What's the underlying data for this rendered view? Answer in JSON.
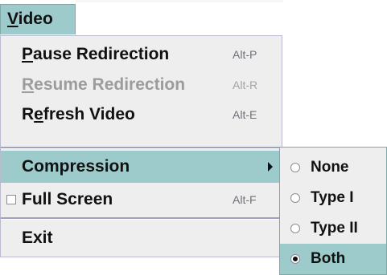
{
  "menubar": {
    "title_first": "V",
    "title_rest": "ideo"
  },
  "menu": {
    "pause_redirection": {
      "label_first": "P",
      "label_rest": "ause Redirection",
      "accelerator": "Alt-P"
    },
    "resume_redirection": {
      "label_first": "R",
      "label_rest": "esume Redirection",
      "accelerator": "Alt-R"
    },
    "refresh_video": {
      "label_before": "R",
      "label_mnemonic": "e",
      "label_after": "fresh Video",
      "accelerator": "Alt-E"
    },
    "compression": {
      "label": "Compression"
    },
    "full_screen": {
      "label": "Full Screen",
      "accelerator": "Alt-F",
      "checked": false
    },
    "exit": {
      "label": "Exit"
    }
  },
  "compression_submenu": {
    "options": [
      {
        "label": "None",
        "selected": false
      },
      {
        "label": "Type I",
        "selected": false
      },
      {
        "label": "Type II",
        "selected": false
      },
      {
        "label": "Both",
        "selected": true
      }
    ]
  },
  "colors": {
    "selection": "#9dcbcb",
    "menu_background": "#eeeeee",
    "menu_border": "#b9b9cf",
    "disabled_text": "#9c9c9c"
  }
}
